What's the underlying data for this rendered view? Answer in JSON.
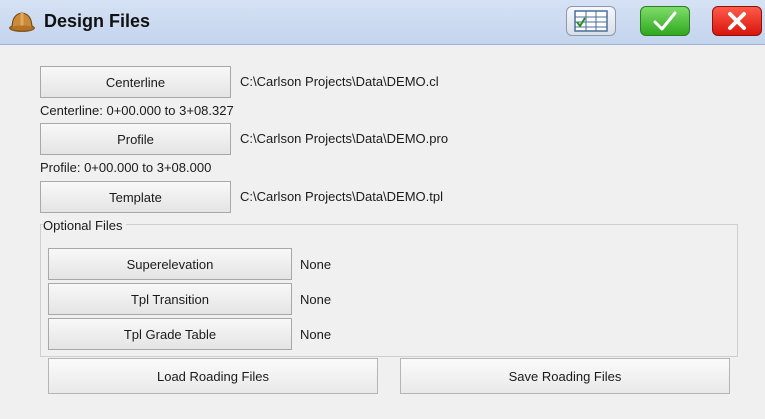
{
  "window": {
    "title": "Design Files",
    "icons": {
      "app": "hardhat-icon",
      "table": "table-icon",
      "ok": "checkmark-icon",
      "cancel": "close-icon"
    },
    "colors": {
      "ok": "#2fa81f",
      "cancel": "#d8150c",
      "titlebar": "#c3d4ee"
    }
  },
  "files": {
    "centerline": {
      "label": "Centerline",
      "path": "C:\\Carlson Projects\\Data\\DEMO.cl",
      "range": "Centerline: 0+00.000 to 3+08.327"
    },
    "profile": {
      "label": "Profile",
      "path": "C:\\Carlson Projects\\Data\\DEMO.pro",
      "range": "Profile: 0+00.000 to 3+08.000"
    },
    "template": {
      "label": "Template",
      "path": "C:\\Carlson Projects\\Data\\DEMO.tpl"
    }
  },
  "optional": {
    "title": "Optional Files",
    "superelevation": {
      "label": "Superelevation",
      "value": "None"
    },
    "tpl_transition": {
      "label": "Tpl Transition",
      "value": "None"
    },
    "tpl_grade_table": {
      "label": "Tpl Grade Table",
      "value": "None"
    }
  },
  "actions": {
    "load": "Load Roading Files",
    "save": "Save Roading Files"
  }
}
